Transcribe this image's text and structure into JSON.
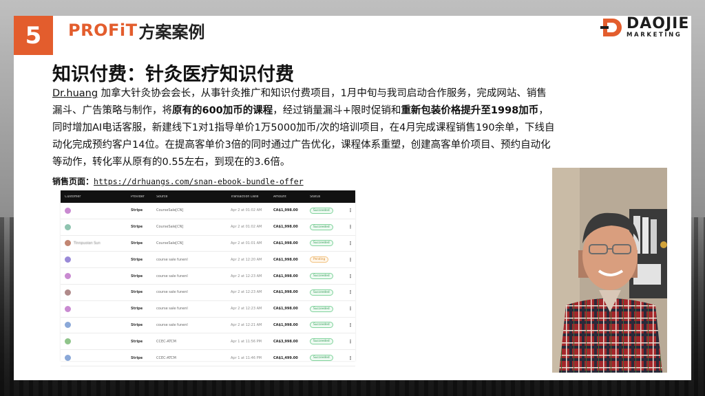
{
  "slide": {
    "number": "5",
    "brand": "PROFiT",
    "title_rest": "方案案例",
    "logo": {
      "word": "DAOJIE",
      "sub": "MARKETING"
    },
    "heading": "知识付费：针灸医疗知识付费",
    "paragraph": {
      "p1": "Dr.huang",
      "p2": " 加拿大针灸协会会长，从事针灸推广和知识付费项目，1月中旬与我司启动合作服务，完成网站、销售漏斗、广告策略与制作，将",
      "b1": "原有的600加币的课程",
      "p3": "，经过销量漏斗+限时促销和",
      "b2": "重新包装价格提升至1998加币",
      "p4": "，同时增加AI电话客服，新建线下1对1指导单价1万5000加币/次的培训项目，在4月完成课程销售190余单，下线自动化完成预约客户14位。在提高客单价3倍的同时通过广告优化，课程体系重塑，创建高客单价项目、预约自动化等动作，转化率从原有的0.55左右，到现在的3.6倍。"
    },
    "sales_label": "销售页面：",
    "sales_url": "https://drhuangs.com/snan-ebook-bundle-offer"
  },
  "table": {
    "headers": [
      "Customer",
      "Provider",
      "Source",
      "Transaction Date",
      "Amount",
      "Status",
      ""
    ],
    "rows": [
      {
        "customer": "",
        "provider": "Stripe",
        "source": "CourseSale[CN]",
        "date": "Apr 2 at 01:02 AM",
        "amount": "CA$1,998.00",
        "status": "Succeeded",
        "avatar": "#c98ad1"
      },
      {
        "customer": "",
        "provider": "Stripe",
        "source": "CourseSale[CN]",
        "date": "Apr 2 at 01:02 AM",
        "amount": "CA$1,998.00",
        "status": "Succeeded",
        "avatar": "#8fc4b0"
      },
      {
        "customer": "Tinnpuoian Sun",
        "provider": "Stripe",
        "source": "CourseSale[CN]",
        "date": "Apr 2 at 01:01 AM",
        "amount": "CA$1,998.00",
        "status": "Succeeded",
        "avatar": "#c28672"
      },
      {
        "customer": "",
        "provider": "Stripe",
        "source": "course sale funenl",
        "date": "Apr 2 at 12:20 AM",
        "amount": "CA$1,998.00",
        "status": "Pending",
        "avatar": "#9a8ad8"
      },
      {
        "customer": "",
        "provider": "Stripe",
        "source": "course sale funenl",
        "date": "Apr 2 at 12:23 AM",
        "amount": "CA$1,998.00",
        "status": "Succeeded",
        "avatar": "#c98ad1"
      },
      {
        "customer": "",
        "provider": "Stripe",
        "source": "course sale funenl",
        "date": "Apr 2 at 12:23 AM",
        "amount": "CA$1,998.00",
        "status": "Succeeded",
        "avatar": "#b08a8a"
      },
      {
        "customer": "",
        "provider": "Stripe",
        "source": "course sale funenl",
        "date": "Apr 2 at 12:23 AM",
        "amount": "CA$1,998.00",
        "status": "Succeeded",
        "avatar": "#c98ad1"
      },
      {
        "customer": "",
        "provider": "Stripe",
        "source": "course sale funenl",
        "date": "Apr 2 at 12:21 AM",
        "amount": "CA$1,998.00",
        "status": "Succeeded",
        "avatar": "#8aa8d8"
      },
      {
        "customer": "",
        "provider": "Stripe",
        "source": "CCEC-ATCM",
        "date": "Apr 1 at 11:56 PM",
        "amount": "CA$3,998.00",
        "status": "Succeeded",
        "avatar": "#8fc48a"
      },
      {
        "customer": "",
        "provider": "Stripe",
        "source": "CCEC-ATCM",
        "date": "Apr 1 at 11:46 PM",
        "amount": "CA$1,499.00",
        "status": "Succeeded",
        "avatar": "#8aa8d8"
      }
    ]
  },
  "colors": {
    "accent": "#e35d2d",
    "success": "#2e9a53",
    "pending": "#d58a27"
  },
  "icons": {
    "row_menu": "kebab-menu-icon",
    "logo_mark": "daojie-d-logo-icon"
  }
}
